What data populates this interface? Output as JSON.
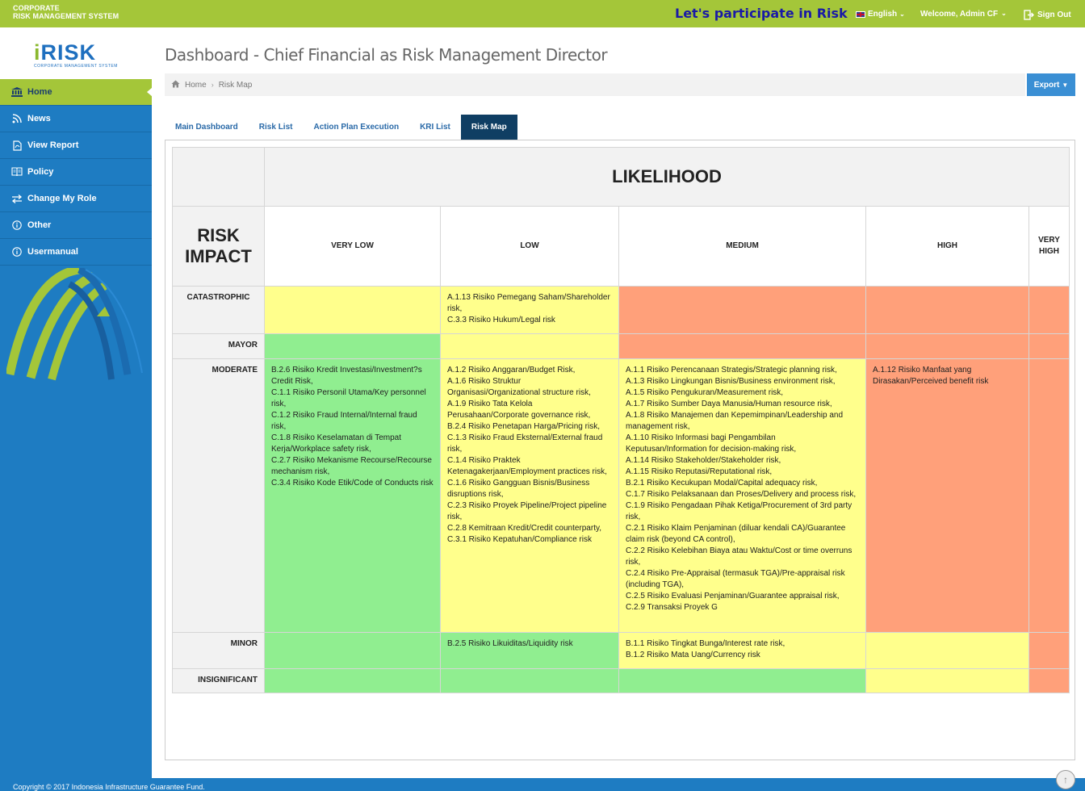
{
  "brand": {
    "line1": "CORPORATE",
    "line2": "RISK MANAGEMENT SYSTEM"
  },
  "topbar": {
    "marquee": "Let's participate in Risk R",
    "language": "English",
    "welcome": "Welcome, Admin CF",
    "signout": "Sign Out"
  },
  "logo": {
    "text_i": "i",
    "text_rest": "RISK",
    "subtitle": "CORPORATE MANAGEMENT SYSTEM"
  },
  "sidebar": {
    "items": [
      {
        "label": "Home",
        "icon": "bank-icon"
      },
      {
        "label": "News",
        "icon": "rss-icon"
      },
      {
        "label": "View Report",
        "icon": "pdf-icon"
      },
      {
        "label": "Policy",
        "icon": "book-icon"
      },
      {
        "label": "Change My Role",
        "icon": "exchange-icon"
      },
      {
        "label": "Other",
        "icon": "info-icon"
      },
      {
        "label": "Usermanual",
        "icon": "info-icon"
      }
    ]
  },
  "page": {
    "title": "Dashboard - Chief Financial as Risk Management Director"
  },
  "breadcrumb": {
    "home": "Home",
    "current": "Risk Map"
  },
  "export": {
    "label": "Export"
  },
  "tabs": [
    "Main Dashboard",
    "Risk List",
    "Action Plan Execution",
    "KRI List",
    "Risk Map"
  ],
  "riskmap": {
    "likelihood_title": "LIKELIHOOD",
    "impact_title_1": "RISK",
    "impact_title_2": "IMPACT",
    "columns": [
      "VERY LOW",
      "LOW",
      "MEDIUM",
      "HIGH",
      "VERY\nHIGH"
    ],
    "col_very_high_1": "VERY",
    "col_very_high_2": "HIGH",
    "rows": [
      {
        "label": "CATASTROPHIC",
        "cells": [
          [],
          [
            "A.1.13 Risiko Pemegang Saham/Shareholder risk,",
            "C.3.3 Risiko Hukum/Legal risk"
          ],
          [],
          [],
          []
        ]
      },
      {
        "label": "MAYOR",
        "cells": [
          [],
          [],
          [],
          [],
          []
        ]
      },
      {
        "label": "MODERATE",
        "cells": [
          [
            "B.2.6 Risiko Kredit Investasi/Investment?s Credit Risk,",
            "C.1.1 Risiko Personil Utama/Key personnel risk,",
            "C.1.2 Risiko Fraud Internal/Internal fraud risk,",
            "C.1.8 Risiko Keselamatan di Tempat Kerja/Workplace safety risk,",
            "C.2.7 Risiko Mekanisme Recourse/Recourse mechanism risk,",
            "C.3.4 Risiko Kode Etik/Code of Conducts risk"
          ],
          [
            "A.1.2 Risiko Anggaran/Budget Risk,",
            "A.1.6 Risiko Struktur Organisasi/Organizational structure risk,",
            "A.1.9 Risiko Tata Kelola Perusahaan/Corporate governance risk,",
            "B.2.4 Risiko Penetapan Harga/Pricing risk,",
            "C.1.3 Risiko Fraud Eksternal/External fraud risk,",
            "C.1.4 Risiko Praktek Ketenagakerjaan/Employment practices risk,",
            "C.1.6 Risiko Gangguan Bisnis/Business disruptions risk,",
            "C.2.3 Risiko Proyek Pipeline/Project pipeline risk,",
            "C.2.8 Kemitraan Kredit/Credit counterparty,",
            "C.3.1 Risiko Kepatuhan/Compliance risk"
          ],
          [
            "A.1.1 Risiko Perencanaan Strategis/Strategic planning risk,",
            "A.1.3 Risiko Lingkungan Bisnis/Business environment risk,",
            "A.1.5 Risiko Pengukuran/Measurement risk,",
            "A.1.7 Risiko Sumber Daya Manusia/Human resource risk,",
            "A.1.8 Risiko Manajemen dan Kepemimpinan/Leadership and management risk,",
            "A.1.10 Risiko Informasi bagi Pengambilan Keputusan/Information for decision-making risk,",
            "A.1.14 Risiko Stakeholder/Stakeholder risk,",
            "A.1.15 Risiko Reputasi/Reputational risk,",
            "B.2.1 Risiko Kecukupan Modal/Capital adequacy risk,",
            "C.1.7 Risiko Pelaksanaan dan Proses/Delivery and process risk,",
            "C.1.9 Risiko Pengadaan Pihak Ketiga/Procurement of 3rd party risk,",
            "C.2.1 Risiko Klaim Penjaminan (diluar kendali CA)/Guarantee claim risk (beyond CA control),",
            "C.2.2 Risiko Kelebihan Biaya atau Waktu/Cost or time overruns risk,",
            "C.2.4 Risiko Pre-Appraisal (termasuk TGA)/Pre-appraisal risk (including TGA),",
            "C.2.5 Risiko Evaluasi Penjaminan/Guarantee appraisal risk,",
            "C.2.9 Transaksi Proyek G"
          ],
          [
            "A.1.12 Risiko Manfaat yang Dirasakan/Perceived benefit risk"
          ],
          []
        ]
      },
      {
        "label": "MINOR",
        "cells": [
          [],
          [
            "B.2.5 Risiko Likuiditas/Liquidity risk"
          ],
          [
            "B.1.1 Risiko Tingkat Bunga/Interest rate risk,",
            "B.1.2 Risiko Mata Uang/Currency risk"
          ],
          [],
          []
        ]
      },
      {
        "label": "INSIGNIFICANT",
        "cells": [
          [],
          [],
          [],
          [],
          []
        ]
      }
    ],
    "colors": {
      "green": "#90ee90",
      "yellow": "#ffff8c",
      "orange": "#ffa07a"
    }
  },
  "footer": {
    "text": "Copyright © 2017 Indonesia Infrastructure Guarantee Fund."
  }
}
